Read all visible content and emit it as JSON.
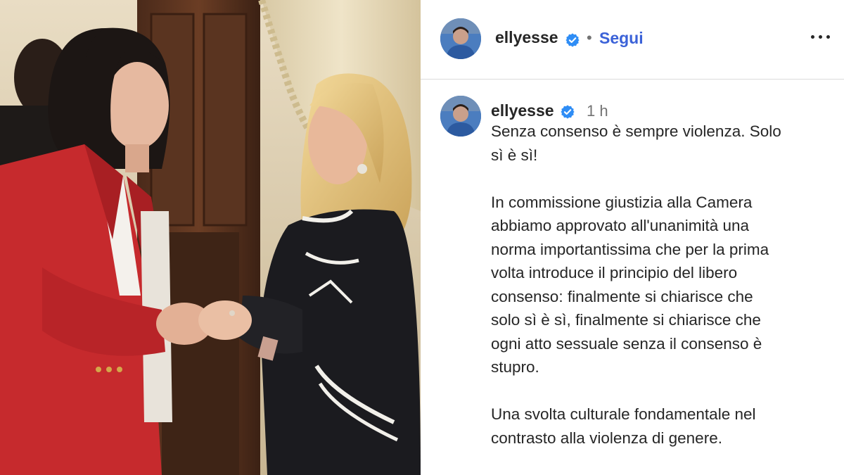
{
  "post": {
    "header": {
      "username": "ellyesse",
      "separator": "•",
      "follow_label": "Segui",
      "more_icon": "more-horizontal-icon"
    },
    "comment": {
      "username": "ellyesse",
      "time": "1 h",
      "caption_lines": [
        "Senza consenso è sempre violenza. Solo",
        "sì è sì!",
        "",
        "In commissione giustizia alla Camera",
        "abbiamo approvato all'unanimità una",
        "norma importantissima che per la prima",
        "volta introduce il principio del libero",
        "consenso: finalmente si chiarisce che",
        "solo sì è sì, finalmente si chiarisce che",
        "ogni atto sessuale senza il consenso è",
        "stupro.",
        "",
        "Una svolta culturale fondamentale nel",
        "contrasto alla violenza di genere."
      ]
    },
    "colors": {
      "follow": "#3b62d8",
      "verified_badge": "#2f8df5",
      "muted_text": "#737373",
      "divider": "#dbdbdb"
    }
  }
}
